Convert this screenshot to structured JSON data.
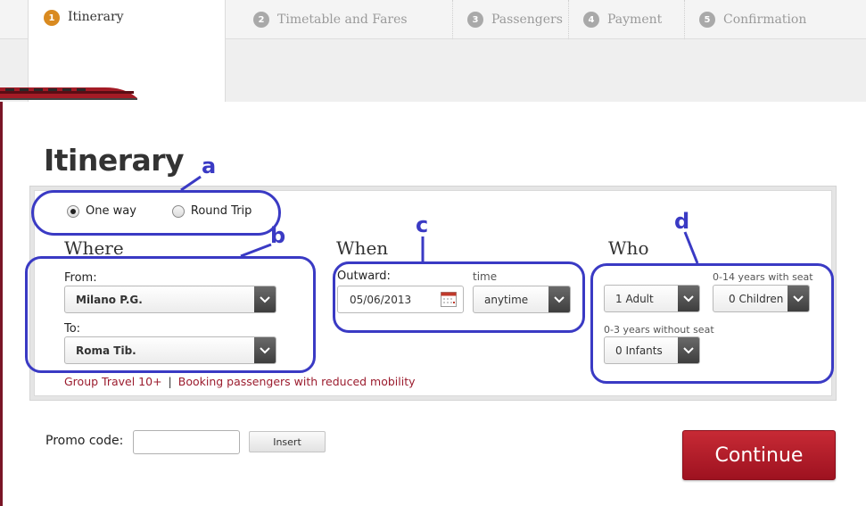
{
  "steps": [
    {
      "num": "1",
      "label": "Itinerary"
    },
    {
      "num": "2",
      "label": "Timetable and Fares"
    },
    {
      "num": "3",
      "label": "Passengers"
    },
    {
      "num": "4",
      "label": "Payment"
    },
    {
      "num": "5",
      "label": "Confirmation"
    }
  ],
  "page_title": "Itinerary",
  "trip_type": {
    "options": [
      "One way",
      "Round Trip"
    ],
    "selected": "One way"
  },
  "where": {
    "heading": "Where",
    "from_label": "From:",
    "from_value": "Milano P.G.",
    "to_label": "To:",
    "to_value": "Roma Tib."
  },
  "when": {
    "heading": "When",
    "outward_label": "Outward:",
    "outward_date": "05/06/2013",
    "time_label": "time",
    "time_value": "anytime"
  },
  "who": {
    "heading": "Who",
    "adults_value": "1 Adult",
    "children_label": "0-14 years with seat",
    "children_value": "0 Children",
    "infants_label": "0-3 years without seat",
    "infants_value": "0 Infants"
  },
  "links": {
    "group_travel": "Group Travel 10+",
    "separator": "|",
    "reduced_mobility": "Booking passengers with reduced mobility"
  },
  "promo": {
    "label": "Promo code:",
    "value": "",
    "insert_label": "Insert"
  },
  "continue_label": "Continue",
  "annotations": [
    "a",
    "b",
    "c",
    "d"
  ],
  "colors": {
    "brand_red": "#9b1c2e",
    "annotation_blue": "#3a3ac4",
    "active_step": "#d98a20"
  }
}
